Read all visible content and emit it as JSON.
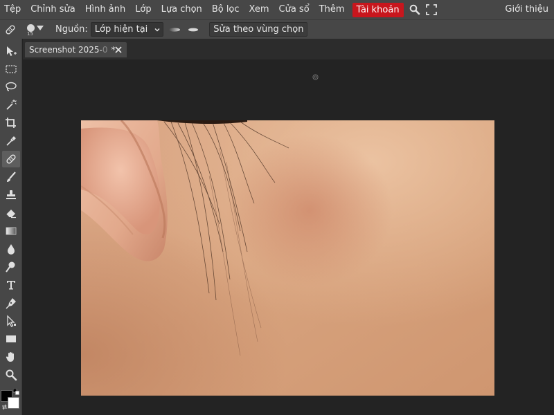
{
  "menubar": {
    "items": [
      "Tệp",
      "Chỉnh sửa",
      "Hình ảnh",
      "Lớp",
      "Lựa chọn",
      "Bộ lọc",
      "Xem",
      "Cửa sổ",
      "Thêm"
    ],
    "account": "Tài khoản",
    "about": "Giới thiệu",
    "search_icon": "search-icon",
    "fullscreen_icon": "fullscreen-icon",
    "account_color": "#c8161d"
  },
  "options": {
    "tool_icon": "healing-brush-icon",
    "brush_size": "15",
    "source_label": "Nguồn:",
    "source_value": "Lớp hiện tại",
    "selection_button": "Sửa theo vùng chọn"
  },
  "tools": [
    "move-select-icon",
    "marquee-icon",
    "lasso-icon",
    "magic-wand-icon",
    "crop-icon",
    "eyedropper-icon",
    "healing-brush-icon",
    "brush-icon",
    "clone-stamp-icon",
    "eraser-icon",
    "gradient-icon",
    "blur-icon",
    "dodge-icon",
    "text-icon",
    "pen-icon",
    "path-select-icon",
    "rectangle-shape-icon",
    "hand-icon",
    "zoom-icon"
  ],
  "active_tool": "healing-brush-icon",
  "colors": {
    "foreground": "#000000",
    "background": "#ffffff"
  },
  "document": {
    "tab_name_main": "Screenshot 2025-",
    "tab_name_fade": "0",
    "modified_marker": "*",
    "image": "close-up of skin, ear and hair (photo)"
  },
  "theme": {
    "panel": "#474747",
    "workspace": "#232323"
  }
}
